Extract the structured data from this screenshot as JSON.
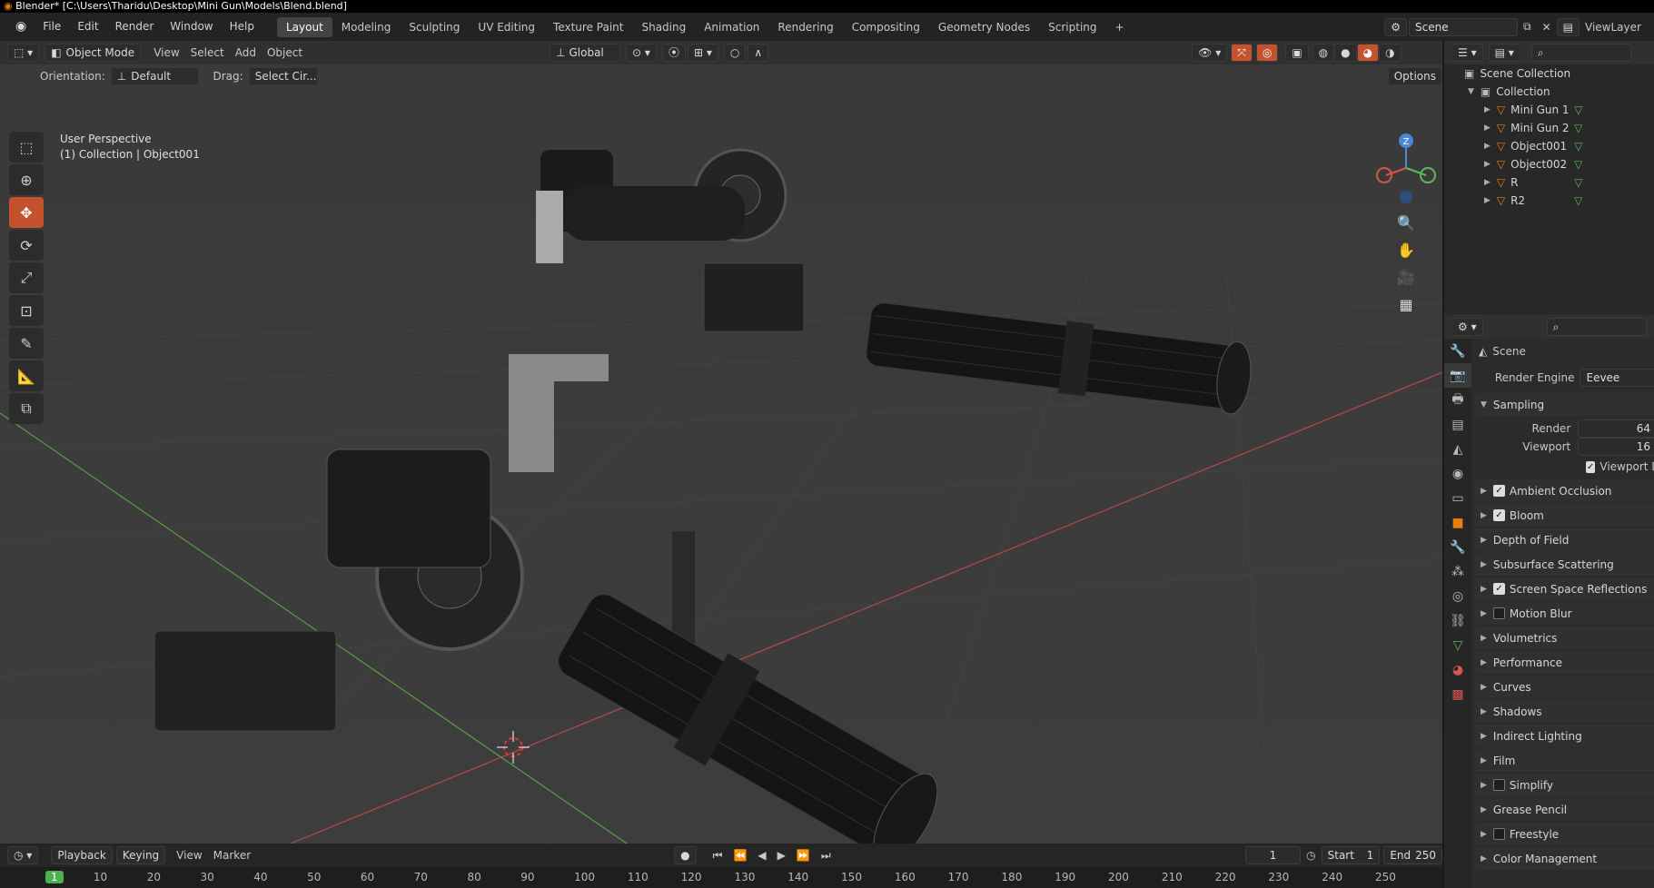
{
  "window_title": "Blender* [C:\\Users\\Tharidu\\Desktop\\Mini Gun\\Models\\Blend.blend]",
  "menu": [
    "File",
    "Edit",
    "Render",
    "Window",
    "Help"
  ],
  "workspaces": [
    "Layout",
    "Modeling",
    "Sculpting",
    "UV Editing",
    "Texture Paint",
    "Shading",
    "Animation",
    "Rendering",
    "Compositing",
    "Geometry Nodes",
    "Scripting"
  ],
  "active_workspace": "Layout",
  "add_workspace": "+",
  "scene_name": "Scene",
  "view_layer": "ViewLayer",
  "viewport": {
    "mode": "Object Mode",
    "menus": [
      "View",
      "Select",
      "Add",
      "Object"
    ],
    "transform": "Global",
    "orientation_label": "Orientation:",
    "orientation_value": "Default",
    "drag_label": "Drag:",
    "drag_value": "Select Cir...",
    "options": "Options",
    "info_line1": "User Perspective",
    "info_line2": "(1) Collection | Object001",
    "gizmo_z": "Z"
  },
  "outliner": {
    "root": "Scene Collection",
    "collection": "Collection",
    "items": [
      "Mini Gun 1",
      "Mini Gun 2",
      "Object001",
      "Object002",
      "R",
      "R2"
    ]
  },
  "properties": {
    "context": "Scene",
    "render_engine_label": "Render Engine",
    "render_engine": "Eevee",
    "sampling": "Sampling",
    "render_label": "Render",
    "render_value": "64",
    "viewport_label": "Viewport",
    "viewport_value": "16",
    "viewport_denoise": "Viewport Denoising",
    "panels": [
      {
        "label": "Ambient Occlusion",
        "check": true
      },
      {
        "label": "Bloom",
        "check": true
      },
      {
        "label": "Depth of Field",
        "check": null
      },
      {
        "label": "Subsurface Scattering",
        "check": null
      },
      {
        "label": "Screen Space Reflections",
        "check": true
      },
      {
        "label": "Motion Blur",
        "check": false
      },
      {
        "label": "Volumetrics",
        "check": null
      },
      {
        "label": "Performance",
        "check": null
      },
      {
        "label": "Curves",
        "check": null
      },
      {
        "label": "Shadows",
        "check": null
      },
      {
        "label": "Indirect Lighting",
        "check": null
      },
      {
        "label": "Film",
        "check": null
      },
      {
        "label": "Simplify",
        "check": false
      },
      {
        "label": "Grease Pencil",
        "check": null
      },
      {
        "label": "Freestyle",
        "check": false
      },
      {
        "label": "Color Management",
        "check": null
      }
    ]
  },
  "timeline": {
    "playback": "Playback",
    "keying": "Keying",
    "view": "View",
    "marker": "Marker",
    "current_frame": "1",
    "start_label": "Start",
    "start": "1",
    "end_label": "End",
    "end": "250",
    "ticks": [
      "1",
      "10",
      "20",
      "30",
      "40",
      "50",
      "60",
      "70",
      "80",
      "90",
      "100",
      "110",
      "120",
      "130",
      "140",
      "150",
      "160",
      "170",
      "180",
      "190",
      "200",
      "210",
      "220",
      "230",
      "240",
      "250"
    ]
  },
  "colors": {
    "accent": "#c3522d",
    "x_axis": "#b44a4a",
    "y_axis": "#5a9c4a",
    "gizmo_x": "#d9534f",
    "gizmo_y": "#5cb85c",
    "gizmo_z": "#4a88d8"
  }
}
